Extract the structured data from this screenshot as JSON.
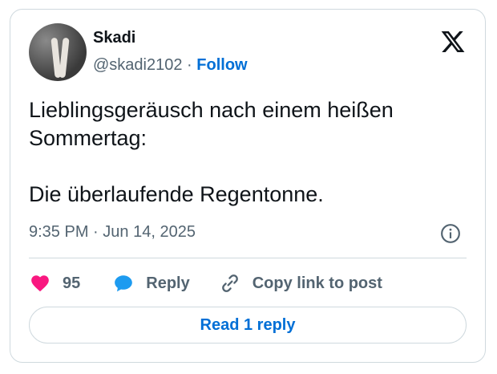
{
  "author": {
    "name": "Skadi",
    "handle": "@skadi2102",
    "separator": "·",
    "follow_label": "Follow"
  },
  "tweet": {
    "text": "Lieblingsgeräusch nach einem heißen\nSommertag:\n\nDie überlaufende Regentonne.",
    "time": "9:35 PM",
    "time_separator": "·",
    "date": "Jun 14, 2025"
  },
  "actions": {
    "like_count": "95",
    "reply_label": "Reply",
    "copy_label": "Copy link to post"
  },
  "read_replies_label": "Read 1 reply",
  "colors": {
    "accent": "#006fd6",
    "like": "#f91880",
    "reply_icon": "#1d9bf0",
    "secondary_text": "#536471",
    "border": "#cfd9de"
  },
  "icons": [
    "x-logo-icon",
    "info-icon",
    "heart-icon",
    "reply-bubble-icon",
    "link-icon"
  ]
}
